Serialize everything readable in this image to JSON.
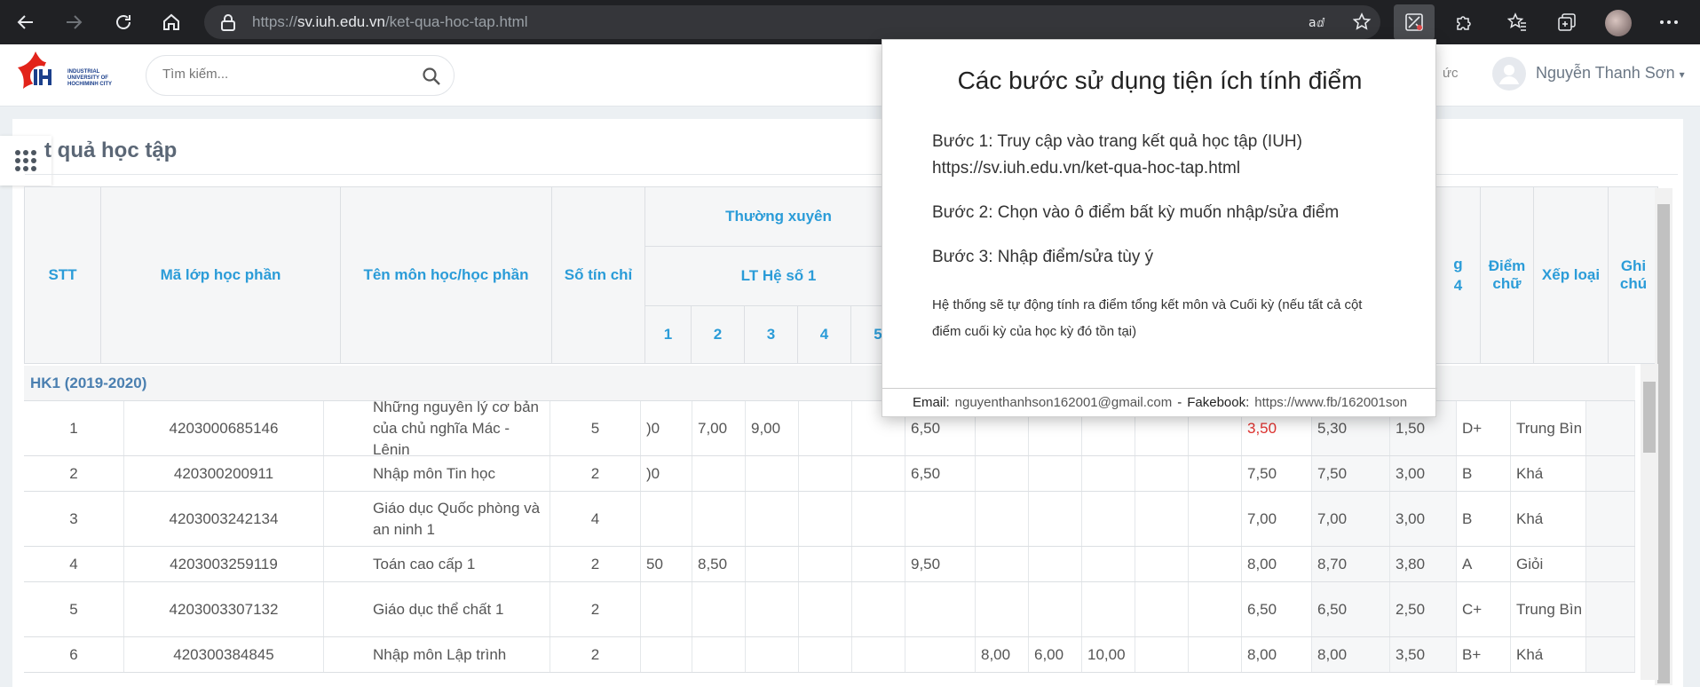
{
  "browser": {
    "url_prefix": "https://",
    "url_host": "sv.iuh.edu.vn",
    "url_path": "/ket-qua-hoc-tap.html"
  },
  "header": {
    "logo_text": "INDUSTRIAL UNIVERSITY OF HOCHIMINH CITY",
    "search_placeholder": "Tìm kiếm...",
    "partial_menu": "ức",
    "user_name": "Nguyễn Thanh Sơn"
  },
  "page": {
    "title": "t quả học tập"
  },
  "table": {
    "headers": {
      "stt": "STT",
      "ma_lop": "Mã lớp học phần",
      "ten_mon": "Tên môn học/học phần",
      "so_tin_chi": "Số tín chỉ",
      "thuong_xuyen": "Thường xuyên",
      "lt_he_so": "LT Hệ số 1",
      "sub1": "1",
      "sub2": "2",
      "sub3": "3",
      "sub4": "4",
      "sub5": "5",
      "diem4_top": "g",
      "diem4_bottom": "4",
      "diem_chu": "Điểm chữ",
      "xep_loai": "Xếp loại",
      "ghi_chu": "Ghi chú"
    },
    "semester": "HK1 (2019-2020)",
    "rows": [
      {
        "stt": "1",
        "ma": "4203000685146",
        "ten": "Những nguyên lý cơ bản của chủ nghĩa Mác - Lênin",
        "tc": "5",
        "x0": ")0",
        "x1": "7,00",
        "x2": "9,00",
        "x3": "",
        "x4": "",
        "gk": "6,50",
        "t1": "",
        "t2": "",
        "t3": "",
        "ck": "3,50",
        "tk10": "5,30",
        "tk4": "1,50",
        "chu": "D+",
        "xl": "Trung Bìn"
      },
      {
        "stt": "2",
        "ma": "420300200911",
        "ten": "Nhập môn Tin học",
        "tc": "2",
        "x0": ")0",
        "x1": "",
        "x2": "",
        "x3": "",
        "x4": "",
        "gk": "6,50",
        "t1": "",
        "t2": "",
        "t3": "",
        "ck": "7,50",
        "tk10": "7,50",
        "tk4": "3,00",
        "chu": "B",
        "xl": "Khá"
      },
      {
        "stt": "3",
        "ma": "4203003242134",
        "ten": "Giáo dục Quốc phòng và an ninh 1",
        "tc": "4",
        "x0": "",
        "x1": "",
        "x2": "",
        "x3": "",
        "x4": "",
        "gk": "",
        "t1": "",
        "t2": "",
        "t3": "",
        "ck": "7,00",
        "tk10": "7,00",
        "tk4": "3,00",
        "chu": "B",
        "xl": "Khá"
      },
      {
        "stt": "4",
        "ma": "4203003259119",
        "ten": "Toán cao cấp 1",
        "tc": "2",
        "x0": "50",
        "x1": "8,50",
        "x2": "",
        "x3": "",
        "x4": "",
        "gk": "9,50",
        "t1": "",
        "t2": "",
        "t3": "",
        "ck": "8,00",
        "tk10": "8,70",
        "tk4": "3,80",
        "chu": "A",
        "xl": "Giỏi"
      },
      {
        "stt": "5",
        "ma": "4203003307132",
        "ten": "Giáo dục thể chất 1",
        "tc": "2",
        "x0": "",
        "x1": "",
        "x2": "",
        "x3": "",
        "x4": "",
        "gk": "",
        "t1": "",
        "t2": "",
        "t3": "",
        "ck": "6,50",
        "tk10": "6,50",
        "tk4": "2,50",
        "chu": "C+",
        "xl": "Trung Bìn"
      },
      {
        "stt": "6",
        "ma": "420300384845",
        "ten": "Nhập môn Lập trình",
        "tc": "2",
        "x0": "",
        "x1": "",
        "x2": "",
        "x3": "",
        "x4": "",
        "gk": "",
        "t1": "8,00",
        "t2": "6,00",
        "t3": "10,00",
        "ck": "8,00",
        "tk10": "8,00",
        "tk4": "3,50",
        "chu": "B+",
        "xl": "Khá"
      }
    ]
  },
  "popup": {
    "title": "Các bước sử dụng tiện ích tính điểm",
    "step1": "Bước 1: Truy cập vào trang kết quả học tập (IUH)",
    "step1_url": "https://sv.iuh.edu.vn/ket-qua-hoc-tap.html",
    "step2": "Bước 2: Chọn vào ô điểm bất kỳ muốn nhập/sửa điểm",
    "step3": "Bước 3: Nhập điểm/sửa tùy ý",
    "note": "Hệ thống sẽ tự động tính ra điểm tổng kết môn và Cuối kỳ (nếu tất cả cột điểm cuối kỳ của học kỳ đó tồn tại)",
    "email_label": "Email:",
    "email": "nguyenthanhson162001@gmail.com",
    "dash": "-",
    "fb_label": "Fakebook:",
    "fb": "https://www.fb/162001son"
  },
  "colors": {
    "header_blue": "#2b9cd8",
    "red_score": "#e0322f",
    "chrome_bg": "#202124"
  }
}
